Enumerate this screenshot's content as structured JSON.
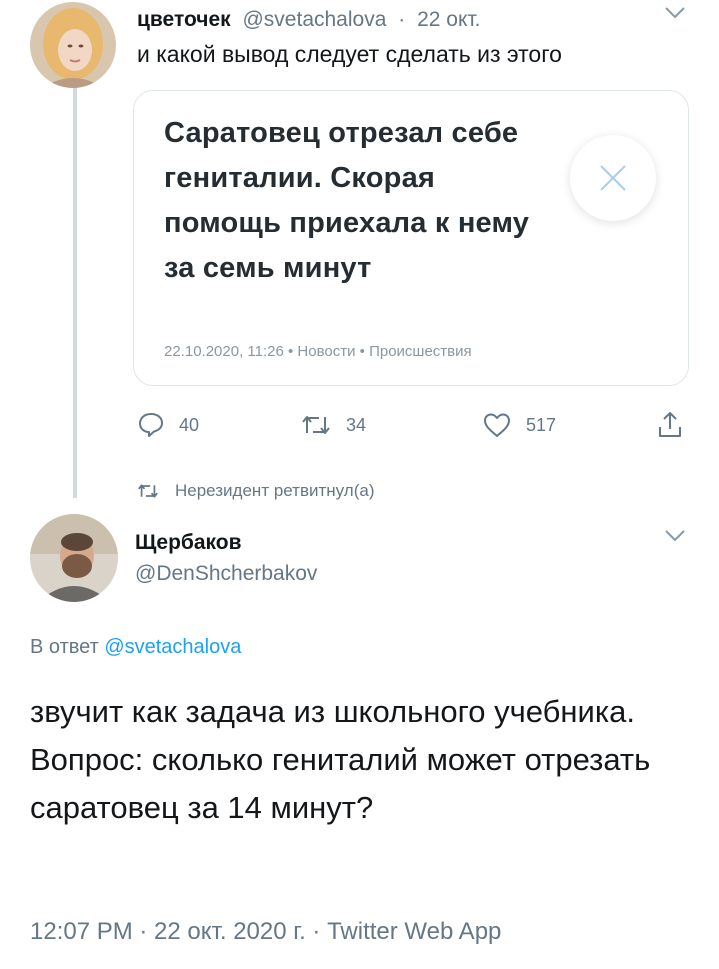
{
  "tweet1": {
    "display_name": "цветочек",
    "handle": "@svetachalova",
    "separator": "·",
    "date": "22 окт.",
    "text": "и какой вывод следует сделать из этого",
    "card": {
      "title": "Саратовец отрезал себе гениталии. Скорая помощь приехала к нему за семь минут",
      "meta": "22.10.2020, 11:26 • Новости • Происшествия"
    },
    "actions": {
      "replies": "40",
      "retweets": "34",
      "likes": "517"
    }
  },
  "retweet_note": "Нерезидент ретвитнул(а)",
  "tweet2": {
    "display_name": "Щербаков",
    "handle": "@DenShcherbakov",
    "reply_prefix": "В ответ",
    "reply_to": "@svetachalova",
    "text": "звучит как задача из школьного учебника. Вопрос: сколько гениталий может отрезать саратовец за 14 минут?",
    "footer": "12:07 PM · 22 окт. 2020 г. · Twitter Web App"
  },
  "colors": {
    "link": "#1da1f2",
    "muted": "#657786",
    "thread_line": "#cfd9de"
  },
  "icons": [
    "chevron-down-icon",
    "close-icon",
    "reply-icon",
    "retweet-icon",
    "like-icon",
    "share-icon"
  ]
}
